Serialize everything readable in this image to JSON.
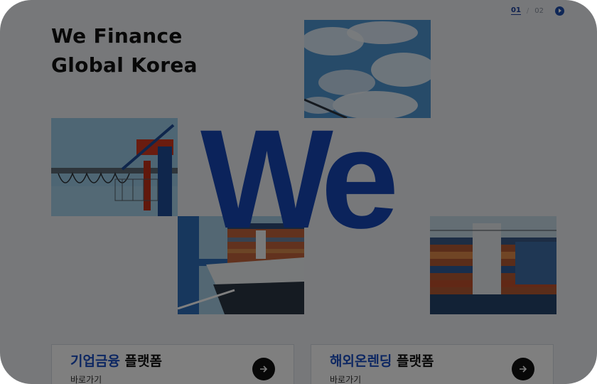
{
  "headline": {
    "line1": "We Finance",
    "line2": "Global Korea"
  },
  "pager": {
    "current": "01",
    "separator": "/",
    "total": "02",
    "play_icon": "play-icon"
  },
  "hero": {
    "big_text": "We"
  },
  "photos": [
    {
      "name": "sky-clouds-photo"
    },
    {
      "name": "port-crane-photo"
    },
    {
      "name": "container-ship-photo"
    },
    {
      "name": "stacked-containers-photo"
    }
  ],
  "cards": [
    {
      "highlight": "기업금융",
      "rest": " 플랫폼",
      "link": "바로가기",
      "icon": "arrow-right-icon"
    },
    {
      "highlight": "해외온렌딩",
      "rest": " 플랫폼",
      "link": "바로가기",
      "icon": "arrow-right-icon"
    }
  ],
  "colors": {
    "brand_blue": "#1647b7",
    "overlay": "rgba(0,0,0,0.5)"
  }
}
